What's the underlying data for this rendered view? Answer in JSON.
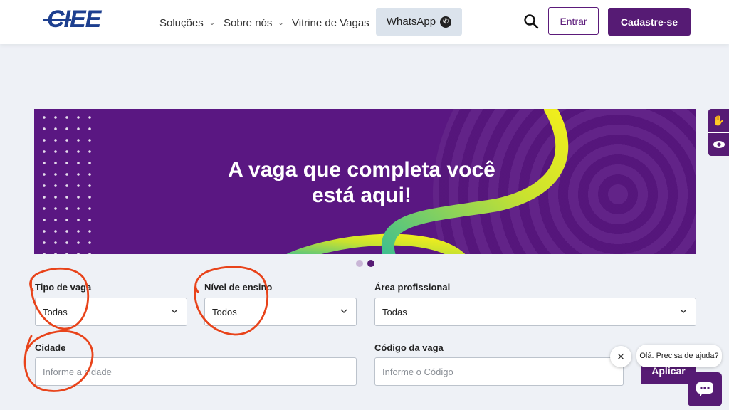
{
  "brand": {
    "logo_text": "CIEE"
  },
  "nav": {
    "items": [
      {
        "label": "Soluções",
        "has_dropdown": true
      },
      {
        "label": "Sobre nós",
        "has_dropdown": true
      },
      {
        "label": "Vitrine de Vagas",
        "has_dropdown": false
      }
    ],
    "whatsapp_label": "WhatsApp",
    "login_label": "Entrar",
    "signup_label": "Cadastre-se"
  },
  "banner": {
    "title_line1": "A vaga que completa você",
    "title_line2": "está aqui!",
    "slides": 2,
    "active_slide": 2
  },
  "filters": {
    "tipo_vaga": {
      "label": "Tipo de vaga",
      "value": "Todas"
    },
    "nivel_ensino": {
      "label": "Nível de ensino",
      "value": "Todos"
    },
    "area_profissional": {
      "label": "Área profissional",
      "value": "Todas"
    },
    "cidade": {
      "label": "Cidade",
      "placeholder": "Informe a cidade"
    },
    "codigo_vaga": {
      "label": "Código da vaga",
      "placeholder": "Informe o Código"
    },
    "apply_label": "Aplicar"
  },
  "chat": {
    "bubble_text": "Olá. Precisa de ajuda?"
  },
  "colors": {
    "primary": "#561b74",
    "logo": "#1d3f8f",
    "annotation": "#e8431a"
  }
}
